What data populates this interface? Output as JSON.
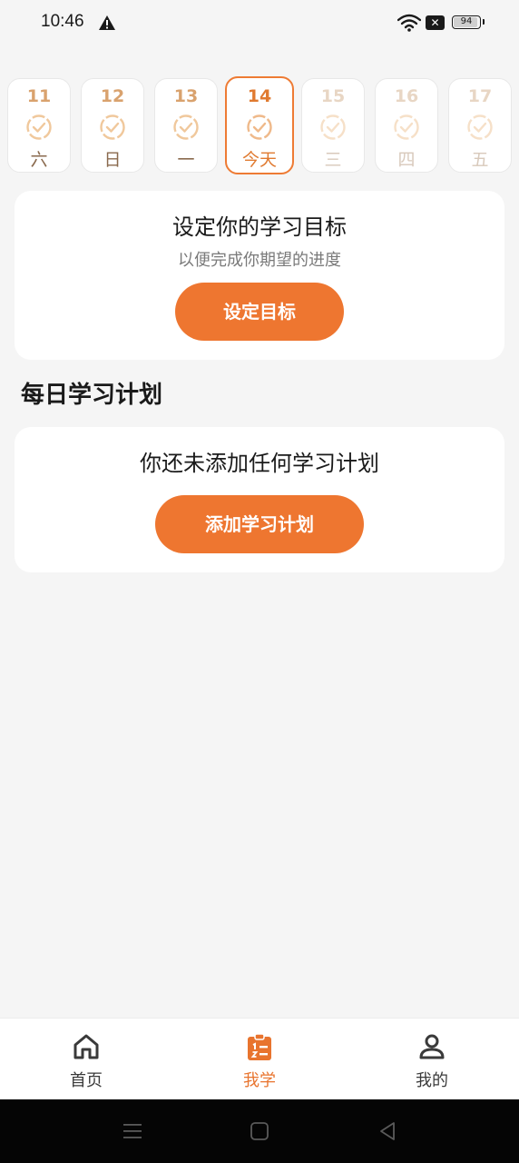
{
  "status_bar": {
    "time": "10:46",
    "battery": "94",
    "battery_level": 0.94
  },
  "days": [
    {
      "num": "11",
      "label": "六",
      "state": "past"
    },
    {
      "num": "12",
      "label": "日",
      "state": "past"
    },
    {
      "num": "13",
      "label": "一",
      "state": "past"
    },
    {
      "num": "14",
      "label": "今天",
      "state": "today"
    },
    {
      "num": "15",
      "label": "三",
      "state": "future"
    },
    {
      "num": "16",
      "label": "四",
      "state": "future"
    },
    {
      "num": "17",
      "label": "五",
      "state": "future"
    }
  ],
  "goal": {
    "title": "设定你的学习目标",
    "subtitle": "以便完成你期望的进度",
    "button": "设定目标"
  },
  "plan_section": {
    "title": "每日学习计划",
    "empty_text": "你还未添加任何学习计划",
    "button": "添加学习计划"
  },
  "bottom_nav": {
    "items": [
      {
        "label": "首页",
        "icon": "home-icon",
        "active": false
      },
      {
        "label": "我学",
        "icon": "study-plan-icon",
        "active": true
      },
      {
        "label": "我的",
        "icon": "profile-icon",
        "active": false
      }
    ]
  },
  "colors": {
    "accent": "#ee7630",
    "background": "#f5f5f5",
    "card": "#ffffff"
  }
}
